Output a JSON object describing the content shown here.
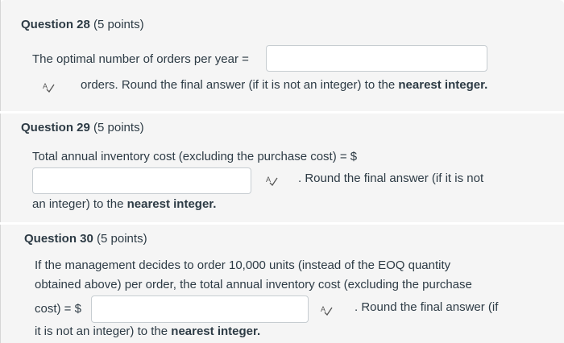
{
  "questions": [
    {
      "title_label": "Question 28",
      "points": "(5 points)",
      "lines": [
        "The optimal number of orders per year ="
      ],
      "after_box": "orders. Round the final answer (if it is not an integer) to the",
      "bold": "nearest integer.",
      "input_value": ""
    },
    {
      "title_label": "Question 29",
      "points": "(5 points)",
      "lines": [
        "Total annual inventory cost (excluding the purchase cost) = $"
      ],
      "after_box": ". Round the final answer (if it is not",
      "line2_prefix": "an integer) to the",
      "bold": "nearest integer.",
      "input_value": ""
    },
    {
      "title_label": "Question 30",
      "points": "(5 points)",
      "lines": [
        "If the management decides to order 10,000 units (instead of the EOQ quantity",
        "obtained above) per order, the total annual inventory cost (excluding the purchase"
      ],
      "before_box": "cost) = $",
      "after_box": ". Round the final answer (if",
      "line2_prefix": "it is not an integer) to the",
      "bold": "nearest integer.",
      "input_value": ""
    }
  ],
  "icons": {
    "spellcheck": "spellcheck-icon"
  }
}
